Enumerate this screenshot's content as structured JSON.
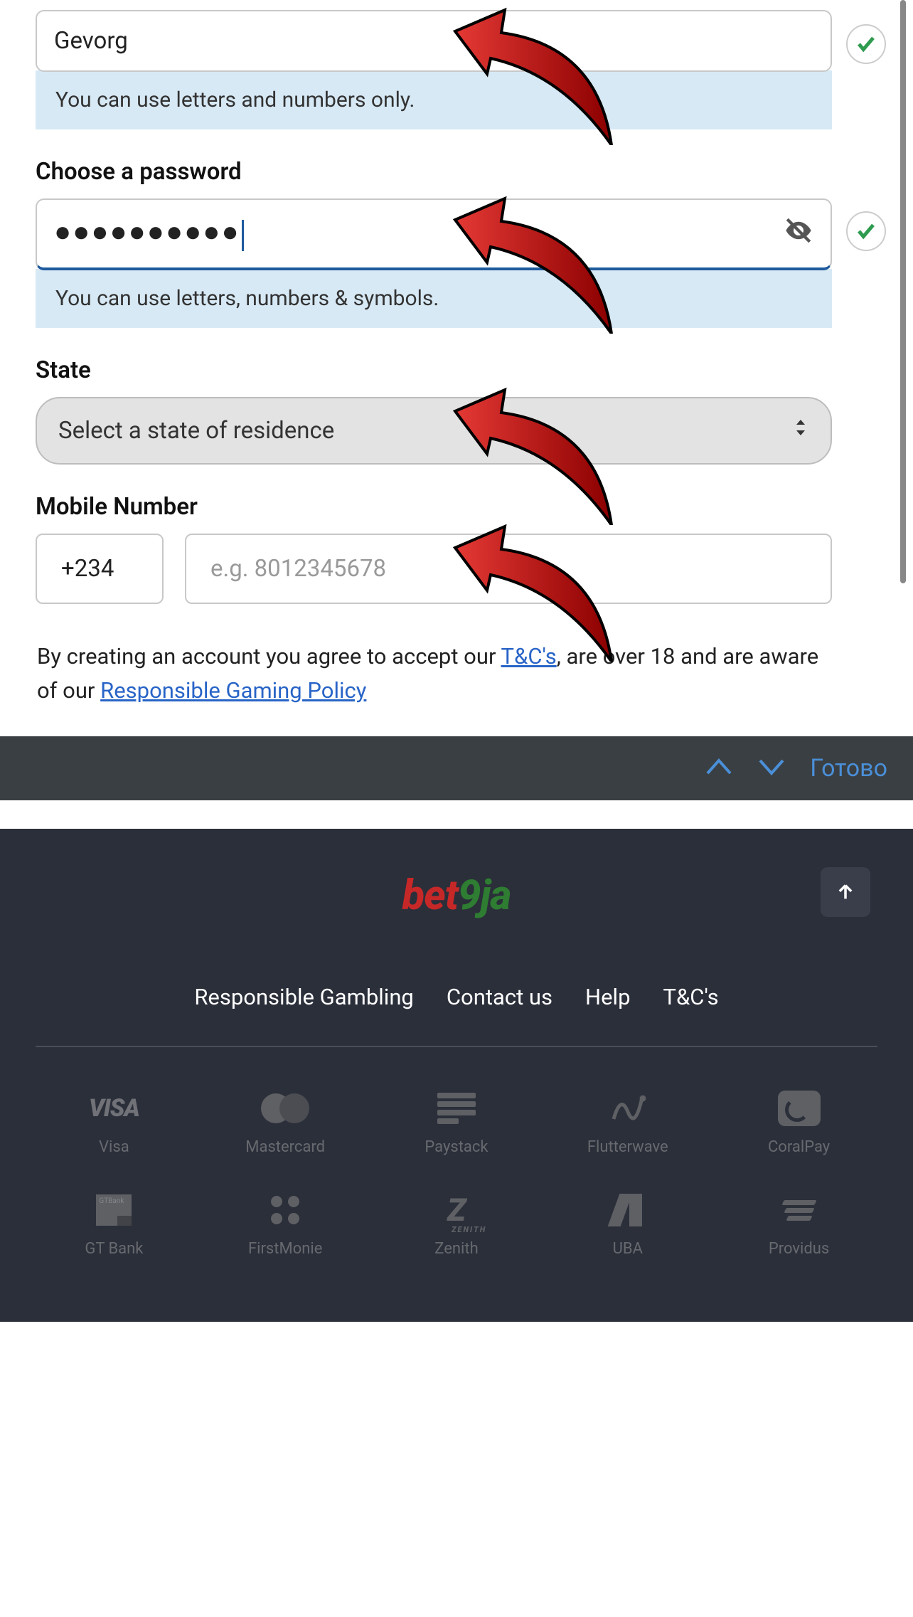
{
  "form": {
    "username": {
      "value": "Gevorg",
      "hint": "You can use letters and numbers only."
    },
    "password": {
      "label": "Choose a password",
      "value_masked": "●●●●●●●●●●",
      "hint": "You can use letters, numbers & symbols."
    },
    "state": {
      "label": "State",
      "placeholder": "Select a state of residence"
    },
    "mobile": {
      "label": "Mobile Number",
      "prefix": "+234",
      "placeholder": "e.g. 8012345678"
    },
    "terms": {
      "prefix": "By creating an account you agree to accept our ",
      "tc_link": "T&C's",
      "mid": ", are over 18 and are aware of our ",
      "policy_link": "Responsible Gaming Policy"
    }
  },
  "keyboard": {
    "done": "Готово"
  },
  "footer": {
    "logo": {
      "bet": "bet",
      "nine": "9",
      "ja": "ja"
    },
    "links": [
      "Responsible Gambling",
      "Contact us",
      "Help",
      "T&C's"
    ],
    "payments_row1": [
      "Visa",
      "Mastercard",
      "Paystack",
      "Flutterwave",
      "CoralPay"
    ],
    "payments_row2": [
      "GT Bank",
      "FirstMonie",
      "Zenith",
      "UBA",
      "Providus"
    ]
  }
}
